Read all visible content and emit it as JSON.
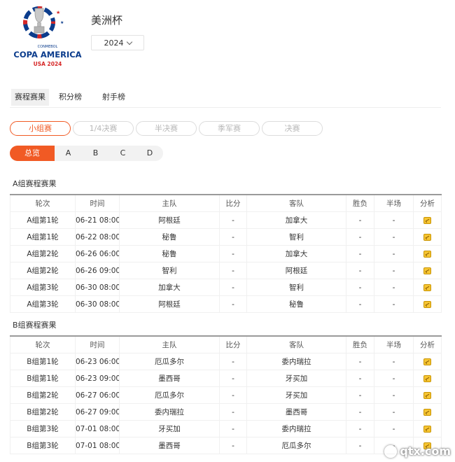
{
  "logo": {
    "small": "CONMEBOL",
    "main": "COPA AMERICA",
    "sub": "USA 2024"
  },
  "page_title": "美洲杯",
  "year_select": {
    "value": "2024"
  },
  "tabs": [
    "赛程赛果",
    "积分榜",
    "射手榜"
  ],
  "stages": [
    "小组赛",
    "1/4决赛",
    "半决赛",
    "季军赛",
    "决赛"
  ],
  "groups": [
    "总览",
    "A",
    "B",
    "C",
    "D"
  ],
  "columns": [
    "轮次",
    "时间",
    "主队",
    "比分",
    "客队",
    "胜负",
    "半场",
    "分析"
  ],
  "sections": [
    {
      "title": "A组赛程赛果",
      "rows": [
        {
          "round": "A组第1轮",
          "time": "06-21 08:00",
          "home": "阿根廷",
          "score": "-",
          "away": "加拿大",
          "result": "-",
          "half": "-"
        },
        {
          "round": "A组第1轮",
          "time": "06-22 08:00",
          "home": "秘鲁",
          "score": "-",
          "away": "智利",
          "result": "-",
          "half": "-"
        },
        {
          "round": "A组第2轮",
          "time": "06-26 06:00",
          "home": "秘鲁",
          "score": "-",
          "away": "加拿大",
          "result": "-",
          "half": "-"
        },
        {
          "round": "A组第2轮",
          "time": "06-26 09:00",
          "home": "智利",
          "score": "-",
          "away": "阿根廷",
          "result": "-",
          "half": "-"
        },
        {
          "round": "A组第3轮",
          "time": "06-30 08:00",
          "home": "加拿大",
          "score": "-",
          "away": "智利",
          "result": "-",
          "half": "-"
        },
        {
          "round": "A组第3轮",
          "time": "06-30 08:00",
          "home": "阿根廷",
          "score": "-",
          "away": "秘鲁",
          "result": "-",
          "half": "-"
        }
      ]
    },
    {
      "title": "B组赛程赛果",
      "rows": [
        {
          "round": "B组第1轮",
          "time": "06-23 06:00",
          "home": "厄瓜多尔",
          "score": "-",
          "away": "委内瑞拉",
          "result": "-",
          "half": "-"
        },
        {
          "round": "B组第1轮",
          "time": "06-23 09:00",
          "home": "墨西哥",
          "score": "-",
          "away": "牙买加",
          "result": "-",
          "half": "-"
        },
        {
          "round": "B组第2轮",
          "time": "06-27 06:00",
          "home": "厄瓜多尔",
          "score": "-",
          "away": "牙买加",
          "result": "-",
          "half": "-"
        },
        {
          "round": "B组第2轮",
          "time": "06-27 09:00",
          "home": "委内瑞拉",
          "score": "-",
          "away": "墨西哥",
          "result": "-",
          "half": "-"
        },
        {
          "round": "B组第3轮",
          "time": "07-01 08:00",
          "home": "牙买加",
          "score": "-",
          "away": "委内瑞拉",
          "result": "-",
          "half": "-"
        },
        {
          "round": "B组第3轮",
          "time": "07-01 08:00",
          "home": "墨西哥",
          "score": "-",
          "away": "厄瓜多尔",
          "result": "-",
          "half": "-"
        }
      ]
    }
  ],
  "watermark": "qtx.com",
  "colors": {
    "accent": "#f15a24",
    "icon": "#f6c533"
  }
}
